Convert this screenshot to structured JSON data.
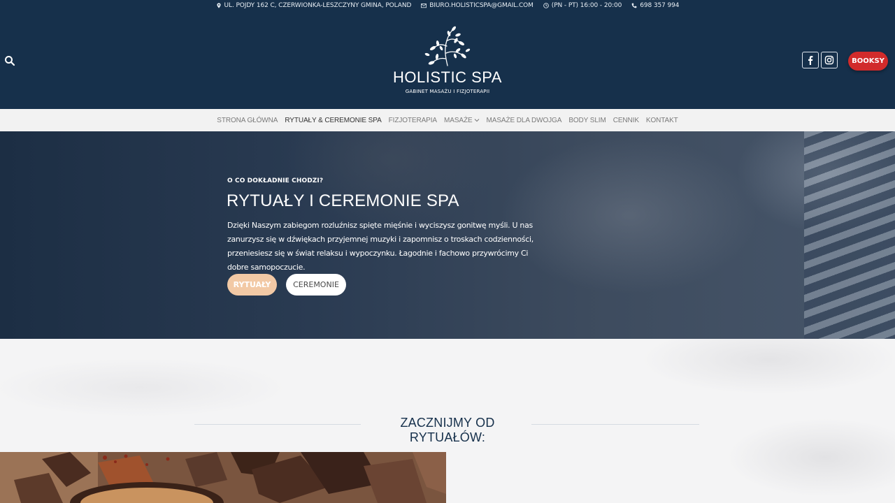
{
  "topbar": {
    "address": "UL. POJDY 162 C, CZERWIONKA-LESZCZYNY GMINA, POLAND",
    "email": "BIURO.HOLISTICSPA@GMAIL.COM",
    "hours": "(PN - PT) 16:00 - 20:00",
    "phone": "698 357 994"
  },
  "header": {
    "logo_title": "HOLISTIC SPA",
    "logo_subtitle": "GABINET MASAŻU I FIZJOTERAPII",
    "booksy_label": "BOOKSY"
  },
  "nav": {
    "items": [
      {
        "label": "STRONA GŁÓWNA"
      },
      {
        "label": "RYTUAŁY & CEREMONIE SPA"
      },
      {
        "label": "FIZJOTERAPIA"
      },
      {
        "label": "MASAŻE"
      },
      {
        "label": "MASAŻE DLA DWOJGA"
      },
      {
        "label": "BODY SLIM"
      },
      {
        "label": "CENNIK"
      },
      {
        "label": "KONTAKT"
      }
    ]
  },
  "hero": {
    "kicker": "O CO DOKŁADNIE CHODZI?",
    "title": "RYTUAŁY I CEREMONIE SPA",
    "text": "Dzięki Naszym zabiegom rozluźnisz spięte mięśnie i wyciszysz gonitwę myśli. U nas zanurzysz się w dźwiękach przyjemnej muzyki i zapomnisz o troskach codzienności, przeniesiesz się w świat relaksu i wypoczynku. Łagodnie i fachowo przywrócimy Ci dobre samopoczucie.",
    "btn_rituals": "RYTUAŁY",
    "btn_ceremonies": "CEREMONIE"
  },
  "section": {
    "title": "ZACZNIJMY OD RYTUAŁÓW:"
  },
  "colors": {
    "navy": "#16304b",
    "booksy_red": "#d12b2b",
    "peach": "#f2c9a5",
    "nav_bg": "#f2f2f2"
  },
  "icons": {
    "address": "map-pin-icon",
    "email": "envelope-icon",
    "hours": "clock-icon",
    "phone": "phone-icon",
    "search": "search-icon",
    "facebook": "facebook-icon",
    "instagram": "instagram-icon",
    "dropdown": "chevron-down-icon"
  }
}
